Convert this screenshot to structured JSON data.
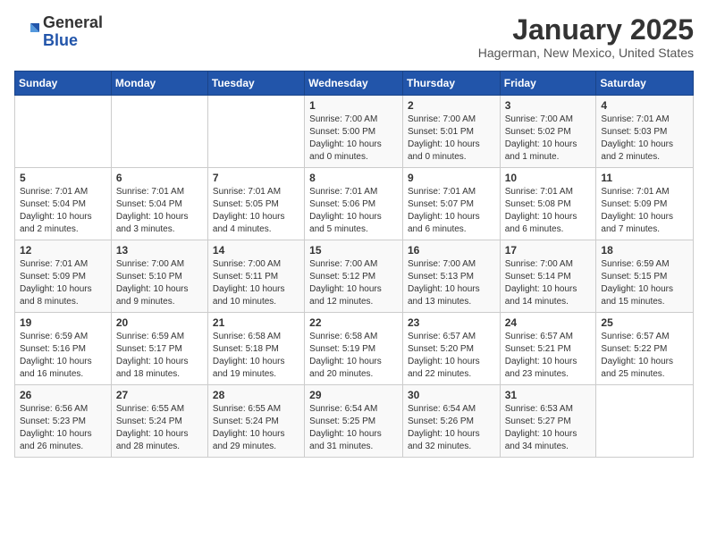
{
  "header": {
    "logo": {
      "general": "General",
      "blue": "Blue"
    },
    "title": "January 2025",
    "location": "Hagerman, New Mexico, United States"
  },
  "weekdays": [
    "Sunday",
    "Monday",
    "Tuesday",
    "Wednesday",
    "Thursday",
    "Friday",
    "Saturday"
  ],
  "weeks": [
    [
      {
        "day": "",
        "text": ""
      },
      {
        "day": "",
        "text": ""
      },
      {
        "day": "",
        "text": ""
      },
      {
        "day": "1",
        "text": "Sunrise: 7:00 AM\nSunset: 5:00 PM\nDaylight: 10 hours\nand 0 minutes."
      },
      {
        "day": "2",
        "text": "Sunrise: 7:00 AM\nSunset: 5:01 PM\nDaylight: 10 hours\nand 0 minutes."
      },
      {
        "day": "3",
        "text": "Sunrise: 7:00 AM\nSunset: 5:02 PM\nDaylight: 10 hours\nand 1 minute."
      },
      {
        "day": "4",
        "text": "Sunrise: 7:01 AM\nSunset: 5:03 PM\nDaylight: 10 hours\nand 2 minutes."
      }
    ],
    [
      {
        "day": "5",
        "text": "Sunrise: 7:01 AM\nSunset: 5:04 PM\nDaylight: 10 hours\nand 2 minutes."
      },
      {
        "day": "6",
        "text": "Sunrise: 7:01 AM\nSunset: 5:04 PM\nDaylight: 10 hours\nand 3 minutes."
      },
      {
        "day": "7",
        "text": "Sunrise: 7:01 AM\nSunset: 5:05 PM\nDaylight: 10 hours\nand 4 minutes."
      },
      {
        "day": "8",
        "text": "Sunrise: 7:01 AM\nSunset: 5:06 PM\nDaylight: 10 hours\nand 5 minutes."
      },
      {
        "day": "9",
        "text": "Sunrise: 7:01 AM\nSunset: 5:07 PM\nDaylight: 10 hours\nand 6 minutes."
      },
      {
        "day": "10",
        "text": "Sunrise: 7:01 AM\nSunset: 5:08 PM\nDaylight: 10 hours\nand 6 minutes."
      },
      {
        "day": "11",
        "text": "Sunrise: 7:01 AM\nSunset: 5:09 PM\nDaylight: 10 hours\nand 7 minutes."
      }
    ],
    [
      {
        "day": "12",
        "text": "Sunrise: 7:01 AM\nSunset: 5:09 PM\nDaylight: 10 hours\nand 8 minutes."
      },
      {
        "day": "13",
        "text": "Sunrise: 7:00 AM\nSunset: 5:10 PM\nDaylight: 10 hours\nand 9 minutes."
      },
      {
        "day": "14",
        "text": "Sunrise: 7:00 AM\nSunset: 5:11 PM\nDaylight: 10 hours\nand 10 minutes."
      },
      {
        "day": "15",
        "text": "Sunrise: 7:00 AM\nSunset: 5:12 PM\nDaylight: 10 hours\nand 12 minutes."
      },
      {
        "day": "16",
        "text": "Sunrise: 7:00 AM\nSunset: 5:13 PM\nDaylight: 10 hours\nand 13 minutes."
      },
      {
        "day": "17",
        "text": "Sunrise: 7:00 AM\nSunset: 5:14 PM\nDaylight: 10 hours\nand 14 minutes."
      },
      {
        "day": "18",
        "text": "Sunrise: 6:59 AM\nSunset: 5:15 PM\nDaylight: 10 hours\nand 15 minutes."
      }
    ],
    [
      {
        "day": "19",
        "text": "Sunrise: 6:59 AM\nSunset: 5:16 PM\nDaylight: 10 hours\nand 16 minutes."
      },
      {
        "day": "20",
        "text": "Sunrise: 6:59 AM\nSunset: 5:17 PM\nDaylight: 10 hours\nand 18 minutes."
      },
      {
        "day": "21",
        "text": "Sunrise: 6:58 AM\nSunset: 5:18 PM\nDaylight: 10 hours\nand 19 minutes."
      },
      {
        "day": "22",
        "text": "Sunrise: 6:58 AM\nSunset: 5:19 PM\nDaylight: 10 hours\nand 20 minutes."
      },
      {
        "day": "23",
        "text": "Sunrise: 6:57 AM\nSunset: 5:20 PM\nDaylight: 10 hours\nand 22 minutes."
      },
      {
        "day": "24",
        "text": "Sunrise: 6:57 AM\nSunset: 5:21 PM\nDaylight: 10 hours\nand 23 minutes."
      },
      {
        "day": "25",
        "text": "Sunrise: 6:57 AM\nSunset: 5:22 PM\nDaylight: 10 hours\nand 25 minutes."
      }
    ],
    [
      {
        "day": "26",
        "text": "Sunrise: 6:56 AM\nSunset: 5:23 PM\nDaylight: 10 hours\nand 26 minutes."
      },
      {
        "day": "27",
        "text": "Sunrise: 6:55 AM\nSunset: 5:24 PM\nDaylight: 10 hours\nand 28 minutes."
      },
      {
        "day": "28",
        "text": "Sunrise: 6:55 AM\nSunset: 5:24 PM\nDaylight: 10 hours\nand 29 minutes."
      },
      {
        "day": "29",
        "text": "Sunrise: 6:54 AM\nSunset: 5:25 PM\nDaylight: 10 hours\nand 31 minutes."
      },
      {
        "day": "30",
        "text": "Sunrise: 6:54 AM\nSunset: 5:26 PM\nDaylight: 10 hours\nand 32 minutes."
      },
      {
        "day": "31",
        "text": "Sunrise: 6:53 AM\nSunset: 5:27 PM\nDaylight: 10 hours\nand 34 minutes."
      },
      {
        "day": "",
        "text": ""
      }
    ]
  ]
}
